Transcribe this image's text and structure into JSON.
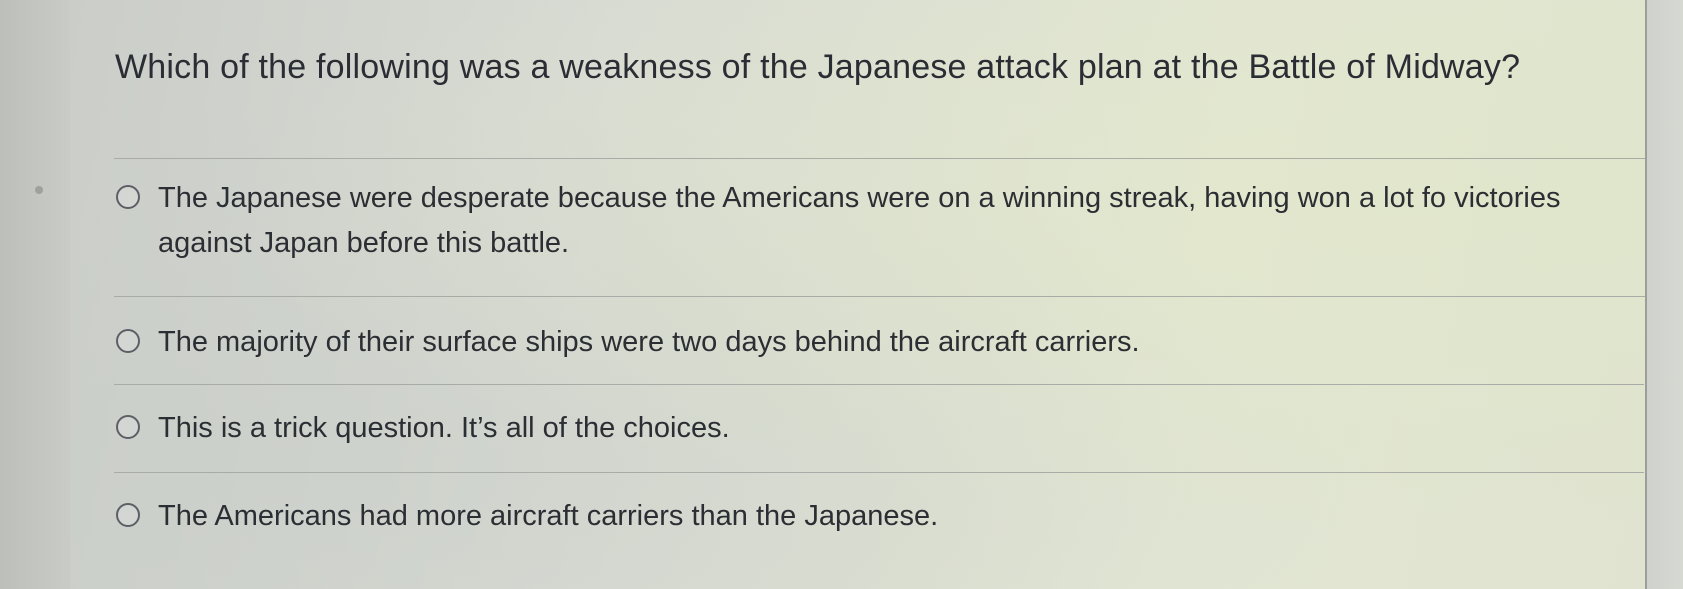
{
  "quiz": {
    "question": "Which of the following was a weakness of the Japanese attack plan at the Battle of Midway?",
    "answers": [
      {
        "label": "The Japanese were desperate because the Americans were on a winning streak, having won a lot fo victories against Japan before this battle.",
        "selected": false
      },
      {
        "label": "The majority of their surface ships were two days behind the aircraft carriers.",
        "selected": false
      },
      {
        "label": "This is a trick question. It’s all of the choices.",
        "selected": false
      },
      {
        "label": "The Americans had more aircraft carriers than the Japanese.",
        "selected": false
      }
    ]
  },
  "colors": {
    "text": "#2a2d33",
    "divider": "#a9aca6",
    "radio_border": "#5c6066"
  }
}
